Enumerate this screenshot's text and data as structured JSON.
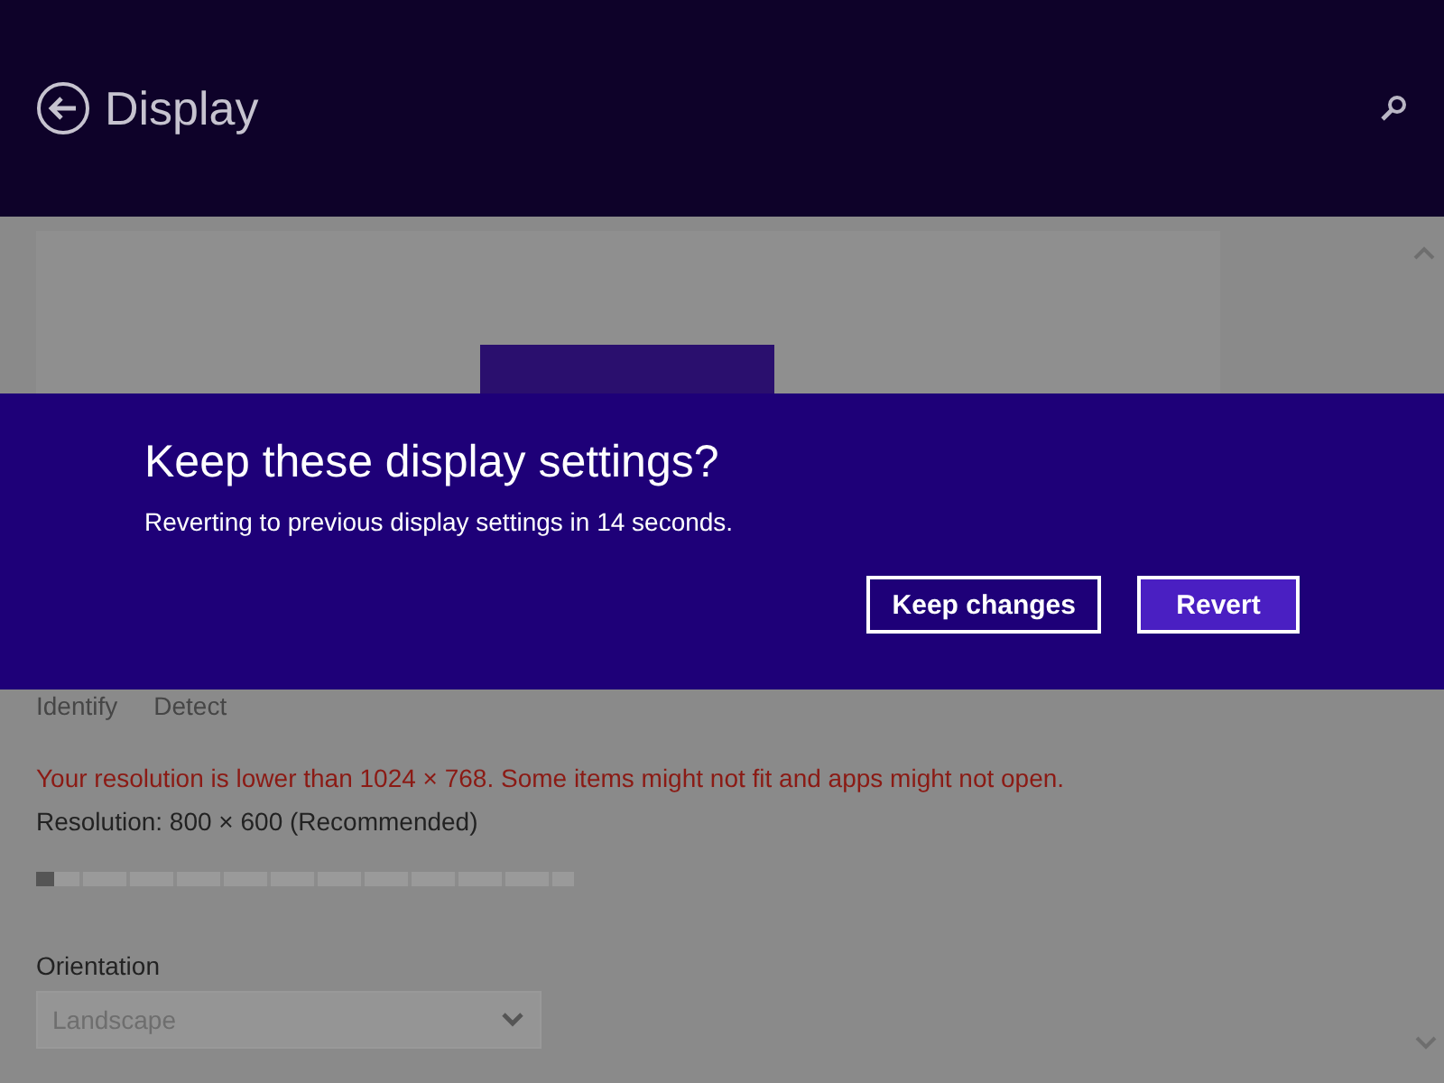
{
  "header": {
    "title": "Display"
  },
  "links": [
    {
      "label": "Identify",
      "disabled": true
    },
    {
      "label": "Detect",
      "disabled": true
    }
  ],
  "warning": "Your resolution is lower than 1024 × 768. Some items might not fit and apps might not open.",
  "resolution": {
    "label": "Resolution: 800 × 600 (Recommended)",
    "level": 0
  },
  "orientation": {
    "label": "Orientation",
    "value": "Landscape",
    "disabled": true
  },
  "dialog": {
    "title": "Keep these display settings?",
    "message": "Reverting to previous display settings in 14 seconds.",
    "buttons": [
      {
        "label": "Keep changes",
        "kind": "outline"
      },
      {
        "label": "Revert",
        "kind": "primary"
      }
    ]
  }
}
